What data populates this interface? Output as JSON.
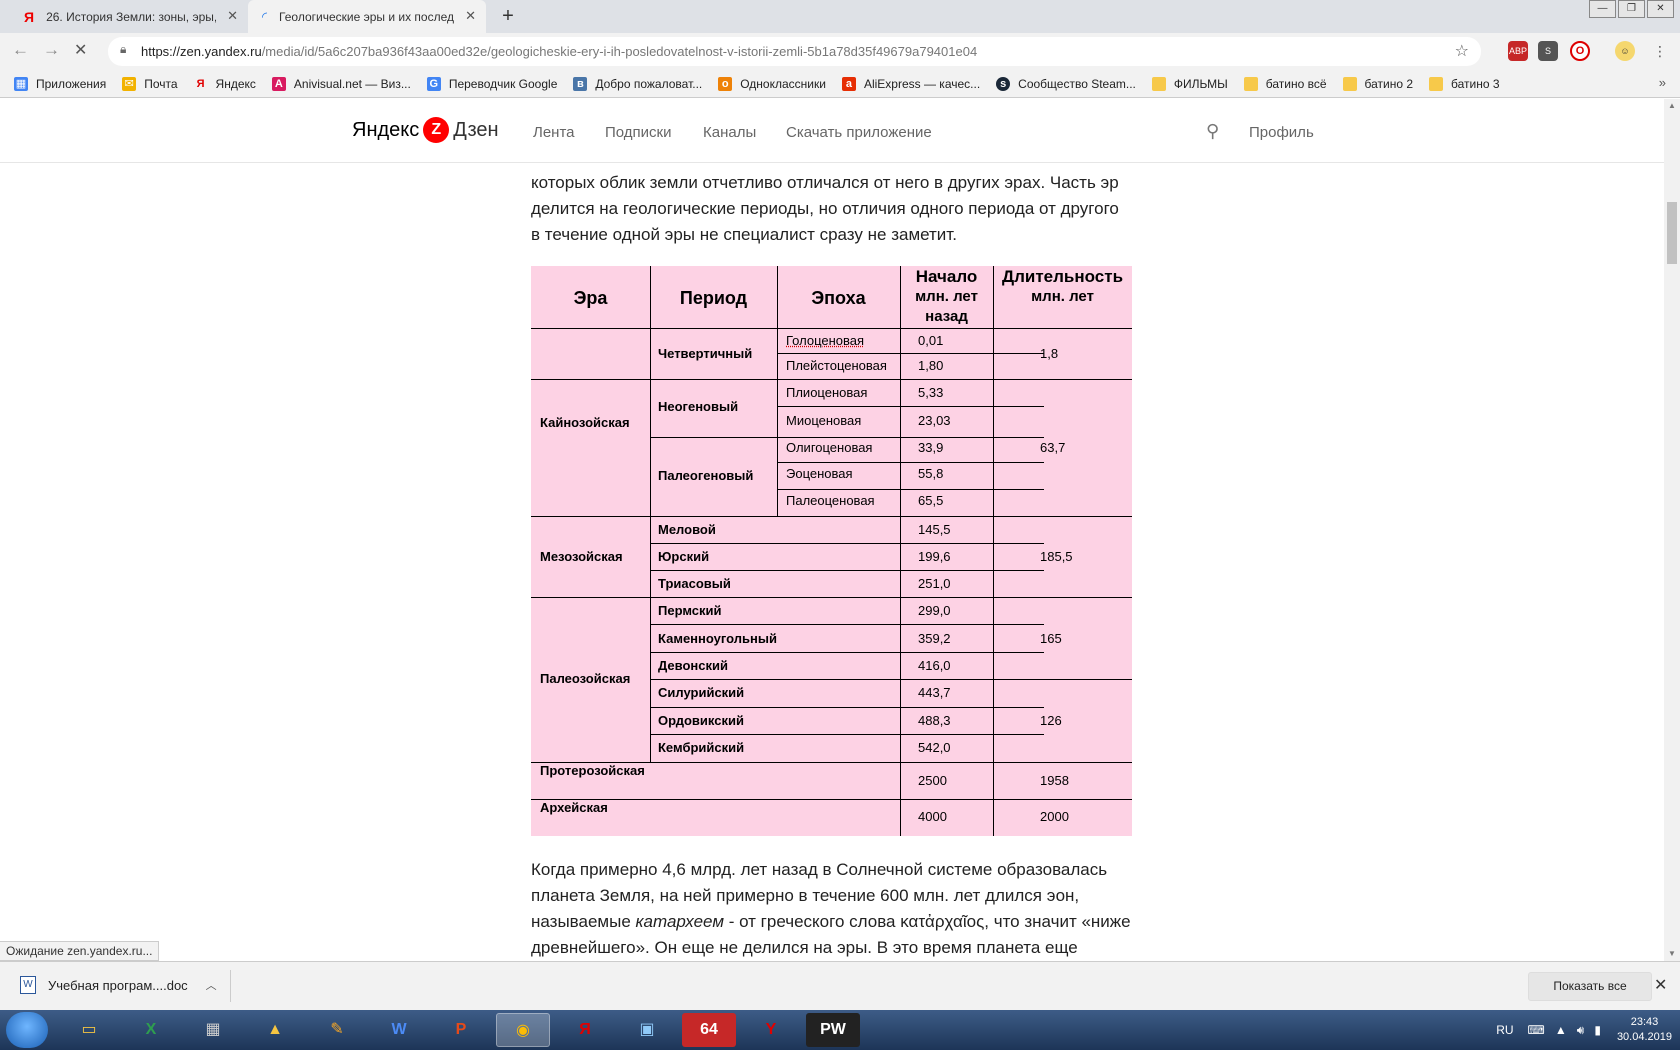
{
  "browser": {
    "tabs": [
      {
        "title": "26. История Земли: зоны, эры, п",
        "icon": "yandex-icon"
      },
      {
        "title": "Геологические эры и их послед",
        "icon": "loading-icon"
      }
    ],
    "url_host": "https://zen.yandex.ru",
    "url_path": "/media/id/5a6c207ba936f43aa00ed32e/geologicheskie-ery-i-ih-posledovatelnost-v-istorii-zemli-5b1a78d35f49679a79401e04",
    "bookmarks": [
      {
        "label": "Приложения",
        "color": "#4285f4"
      },
      {
        "label": "Почта",
        "color": "#f2b200"
      },
      {
        "label": "Яндекс",
        "color": "#e00000"
      },
      {
        "label": "Anivisual.net — Виз...",
        "color": "#d81b60"
      },
      {
        "label": "Переводчик Google",
        "color": "#4285f4"
      },
      {
        "label": "Добро пожаловат...",
        "color": "#4a76a8"
      },
      {
        "label": "Одноклассники",
        "color": "#ee8208"
      },
      {
        "label": "AliExpress — качес...",
        "color": "#e62e04"
      },
      {
        "label": "Сообщество Steam...",
        "color": "#1b2838"
      },
      {
        "label": "ФИЛЬМЫ",
        "color": "folder"
      },
      {
        "label": "батино всё",
        "color": "folder"
      },
      {
        "label": "батино 2",
        "color": "folder"
      },
      {
        "label": "батино 3",
        "color": "folder"
      }
    ],
    "status": "Ожидание zen.yandex.ru..."
  },
  "site": {
    "logo_left": "Яндекс",
    "logo_right": "Дзен",
    "nav": [
      "Лента",
      "Подписки",
      "Каналы",
      "Скачать приложение"
    ],
    "profile": "Профиль"
  },
  "article": {
    "para_top": [
      "которых облик земли отчетливо отличался от него в других эрах. Часть эр",
      "делится на геологические периоды, но отличия одного периода от другого",
      "в течение одной эры не специалист сразу не заметит."
    ],
    "para_bottom_1": "Когда примерно 4,6 млрд. лет назад в Солнечной системе образовалась",
    "para_bottom_2": "планета Земля, на ней примерно в течение 600 млн. лет длился эон,",
    "para_bottom_3a": "называемые ",
    "para_bottom_3i": "катархеем",
    "para_bottom_3b": " - от греческого слова κατἀρχαῖος, что значит «ниже",
    "para_bottom_4": "древнейшего». Он еще не делился на эры. В это время планета еще"
  },
  "table": {
    "headers": {
      "era": "Эра",
      "period": "Период",
      "epoch": "Эпоха",
      "start_1": "Начало",
      "start_2": "млн. лет",
      "start_3": "назад",
      "dur_1": "Длительность",
      "dur_2": "млн. лет"
    },
    "eras": [
      "Кайнозойская",
      "Мезозойская",
      "Палеозойская",
      "Протерозойская",
      "Архейская"
    ],
    "periods": [
      "Четвертичный",
      "Неогеновый",
      "Палеогеновый",
      "Меловой",
      "Юрский",
      "Триасовый",
      "Пермский",
      "Каменноугольный",
      "Девонский",
      "Силурийский",
      "Ордовикский",
      "Кембрийский"
    ],
    "epochs": [
      "Голоценовая",
      "Плейстоценовая",
      "Плиоценовая",
      "Миоценовая",
      "Олигоценовая",
      "Эоценовая",
      "Палеоценовая"
    ],
    "starts": [
      "0,01",
      "1,80",
      "5,33",
      "23,03",
      "33,9",
      "55,8",
      "65,5",
      "145,5",
      "199,6",
      "251,0",
      "299,0",
      "359,2",
      "416,0",
      "443,7",
      "488,3",
      "542,0",
      "2500",
      "4000"
    ],
    "durations": [
      "1,8",
      "63,7",
      "185,5",
      "165",
      "126",
      "1958",
      "2000"
    ]
  },
  "downloads": {
    "file": "Учебная програм....doc",
    "show_all": "Показать все"
  },
  "taskbar": {
    "lang": "RU",
    "time": "23:43",
    "date": "30.04.2019"
  }
}
